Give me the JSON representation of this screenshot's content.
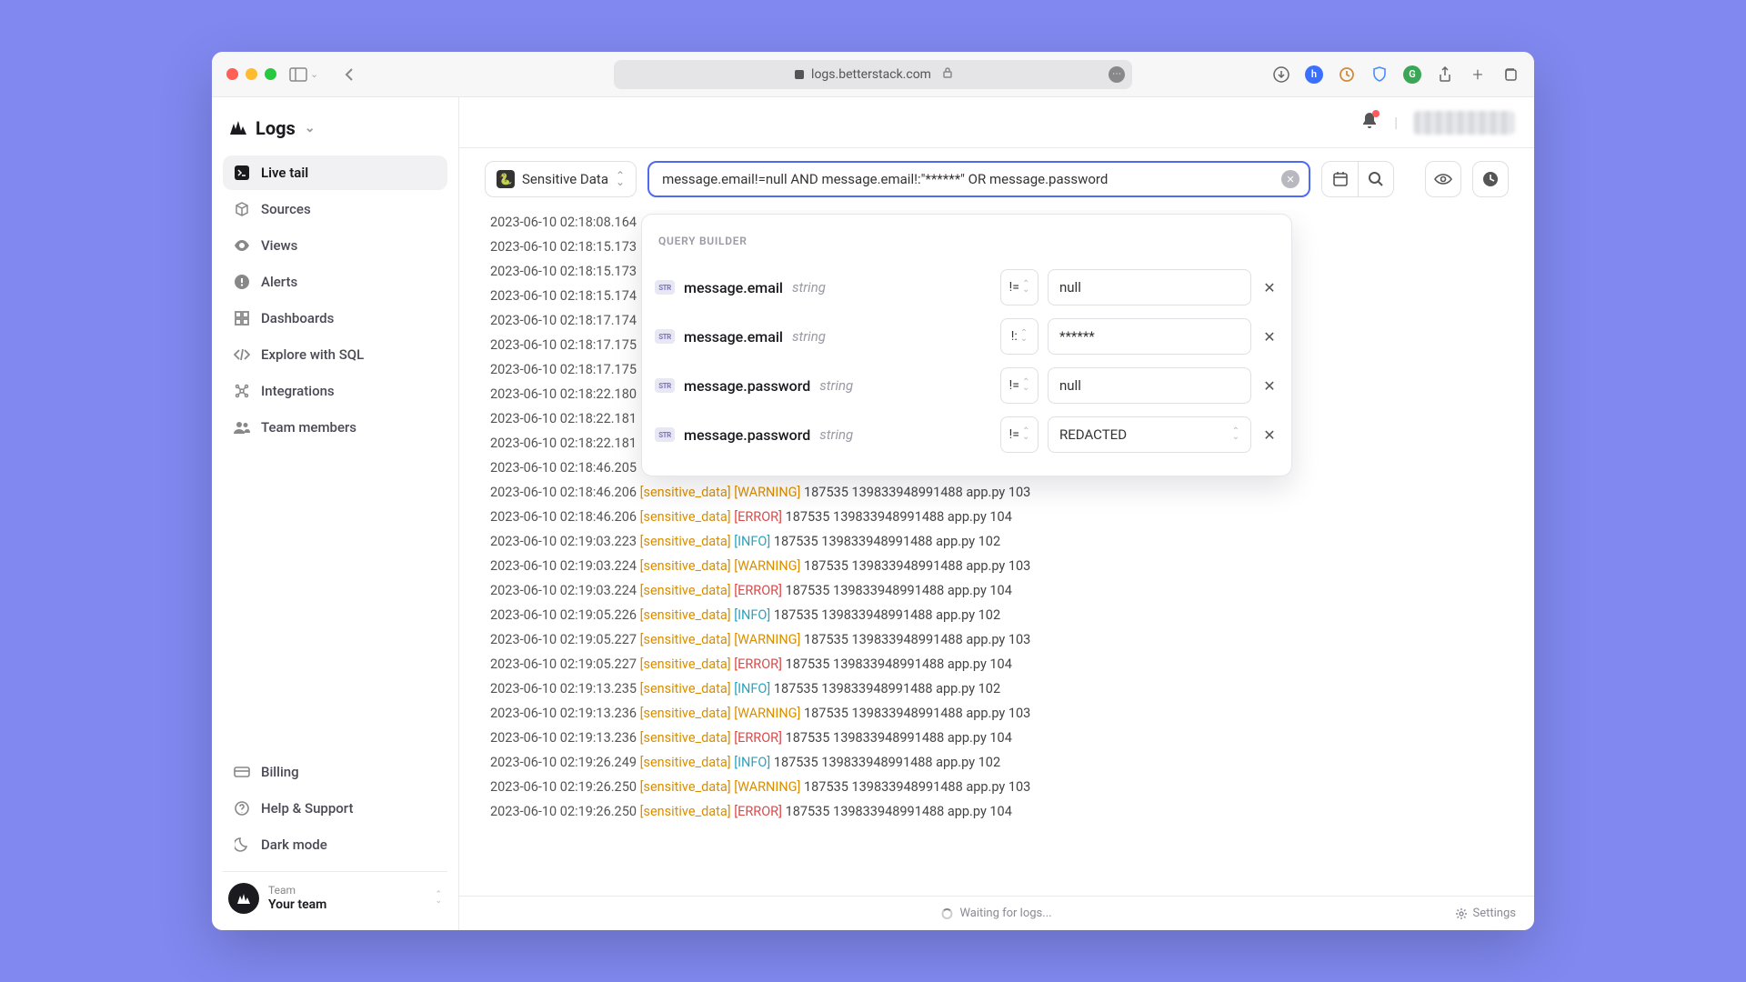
{
  "browser": {
    "url": "logs.betterstack.com"
  },
  "sidebar": {
    "title": "Logs",
    "items": [
      {
        "label": "Live tail",
        "icon": "terminal",
        "active": true
      },
      {
        "label": "Sources",
        "icon": "cube"
      },
      {
        "label": "Views",
        "icon": "eye"
      },
      {
        "label": "Alerts",
        "icon": "alert"
      },
      {
        "label": "Dashboards",
        "icon": "dashboard"
      },
      {
        "label": "Explore with SQL",
        "icon": "code"
      },
      {
        "label": "Integrations",
        "icon": "integrations"
      },
      {
        "label": "Team members",
        "icon": "team"
      }
    ],
    "bottom": [
      {
        "label": "Billing",
        "icon": "card"
      },
      {
        "label": "Help & Support",
        "icon": "help"
      },
      {
        "label": "Dark mode",
        "icon": "moon"
      }
    ],
    "team": {
      "label": "Team",
      "name": "Your team"
    }
  },
  "toolbar": {
    "source_label": "Sensitive Data",
    "query": "message.email!=null AND message.email!:\"******\" OR message.password"
  },
  "query_builder": {
    "title": "QUERY BUILDER",
    "rows": [
      {
        "field": "message.email",
        "type": "string",
        "op": "!=",
        "value": "null",
        "kind": "input"
      },
      {
        "field": "message.email",
        "type": "string",
        "op": "!:",
        "value": "******",
        "kind": "input"
      },
      {
        "field": "message.password",
        "type": "string",
        "op": "!=",
        "value": "null",
        "kind": "input"
      },
      {
        "field": "message.password",
        "type": "string",
        "op": "!=",
        "value": "REDACTED",
        "kind": "select"
      }
    ]
  },
  "logs": [
    {
      "ts": "2023-06-10 02:18:08.164"
    },
    {
      "ts": "2023-06-10 02:18:15.173"
    },
    {
      "ts": "2023-06-10 02:18:15.173"
    },
    {
      "ts": "2023-06-10 02:18:15.174"
    },
    {
      "ts": "2023-06-10 02:18:17.174"
    },
    {
      "ts": "2023-06-10 02:18:17.175"
    },
    {
      "ts": "2023-06-10 02:18:17.175"
    },
    {
      "ts": "2023-06-10 02:18:22.180"
    },
    {
      "ts": "2023-06-10 02:18:22.181"
    },
    {
      "ts": "2023-06-10 02:18:22.181"
    },
    {
      "ts": "2023-06-10 02:18:46.205"
    },
    {
      "ts": "2023-06-10 02:18:46.206",
      "tag": "[sensitive_data]",
      "lvl": "WARNING",
      "rest": "187535 139833948991488 app.py 103"
    },
    {
      "ts": "2023-06-10 02:18:46.206",
      "tag": "[sensitive_data]",
      "lvl": "ERROR",
      "rest": "187535 139833948991488 app.py 104"
    },
    {
      "ts": "2023-06-10 02:19:03.223",
      "tag": "[sensitive_data]",
      "lvl": "INFO",
      "rest": "187535 139833948991488 app.py 102"
    },
    {
      "ts": "2023-06-10 02:19:03.224",
      "tag": "[sensitive_data]",
      "lvl": "WARNING",
      "rest": "187535 139833948991488 app.py 103"
    },
    {
      "ts": "2023-06-10 02:19:03.224",
      "tag": "[sensitive_data]",
      "lvl": "ERROR",
      "rest": "187535 139833948991488 app.py 104"
    },
    {
      "ts": "2023-06-10 02:19:05.226",
      "tag": "[sensitive_data]",
      "lvl": "INFO",
      "rest": "187535 139833948991488 app.py 102"
    },
    {
      "ts": "2023-06-10 02:19:05.227",
      "tag": "[sensitive_data]",
      "lvl": "WARNING",
      "rest": "187535 139833948991488 app.py 103"
    },
    {
      "ts": "2023-06-10 02:19:05.227",
      "tag": "[sensitive_data]",
      "lvl": "ERROR",
      "rest": "187535 139833948991488 app.py 104"
    },
    {
      "ts": "2023-06-10 02:19:13.235",
      "tag": "[sensitive_data]",
      "lvl": "INFO",
      "rest": "187535 139833948991488 app.py 102"
    },
    {
      "ts": "2023-06-10 02:19:13.236",
      "tag": "[sensitive_data]",
      "lvl": "WARNING",
      "rest": "187535 139833948991488 app.py 103"
    },
    {
      "ts": "2023-06-10 02:19:13.236",
      "tag": "[sensitive_data]",
      "lvl": "ERROR",
      "rest": "187535 139833948991488 app.py 104"
    },
    {
      "ts": "2023-06-10 02:19:26.249",
      "tag": "[sensitive_data]",
      "lvl": "INFO",
      "rest": "187535 139833948991488 app.py 102"
    },
    {
      "ts": "2023-06-10 02:19:26.250",
      "tag": "[sensitive_data]",
      "lvl": "WARNING",
      "rest": "187535 139833948991488 app.py 103"
    },
    {
      "ts": "2023-06-10 02:19:26.250",
      "tag": "[sensitive_data]",
      "lvl": "ERROR",
      "rest": "187535 139833948991488 app.py 104"
    }
  ],
  "footer": {
    "waiting": "Waiting for logs...",
    "settings": "Settings"
  }
}
